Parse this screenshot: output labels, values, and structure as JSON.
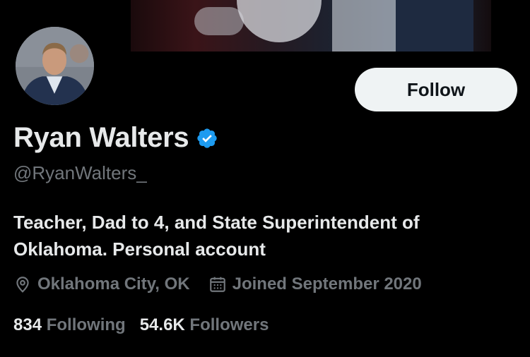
{
  "profile": {
    "name": "Ryan Walters",
    "handle": "@RyanWalters_",
    "bio_line1": "Teacher, Dad to 4, and State Superintendent of",
    "bio_line2": "Oklahoma. Personal account",
    "location": "Oklahoma City, OK",
    "joined": "Joined September 2020",
    "verified": true
  },
  "actions": {
    "follow_label": "Follow"
  },
  "stats": {
    "following_count": "834",
    "following_label": "Following",
    "followers_count": "54.6K",
    "followers_label": "Followers"
  },
  "icons": {
    "location": "location-pin-icon",
    "calendar": "calendar-icon",
    "verified": "verified-badge-icon"
  },
  "colors": {
    "background": "#000000",
    "primary_text": "#e7e9ea",
    "secondary_text": "#71767b",
    "verified_blue": "#1d9bf0",
    "button_bg": "#eff3f4"
  }
}
